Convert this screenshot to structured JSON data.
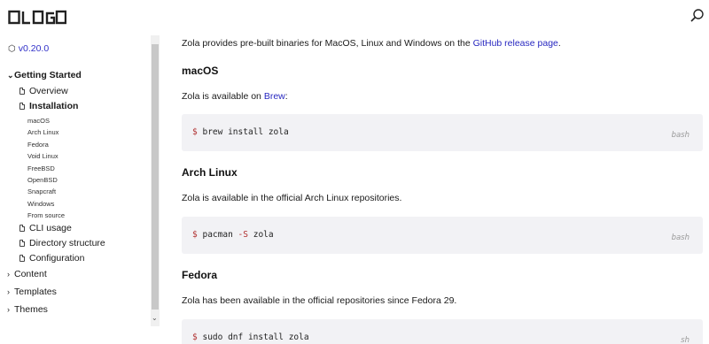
{
  "header": {
    "logo_text": "LOGO",
    "search_icon": "search-icon"
  },
  "sidebar": {
    "version": "v0.20.0",
    "sections": [
      {
        "label": "Getting Started",
        "expanded": true
      },
      {
        "label": "Content",
        "expanded": false
      },
      {
        "label": "Templates",
        "expanded": false
      },
      {
        "label": "Themes",
        "expanded": false
      }
    ],
    "getting_started_items": [
      {
        "label": "Overview"
      },
      {
        "label": "Installation",
        "active": true
      },
      {
        "label": "CLI usage"
      },
      {
        "label": "Directory structure"
      },
      {
        "label": "Configuration"
      }
    ],
    "installation_subitems": [
      "macOS",
      "Arch Linux",
      "Fedora",
      "Void Linux",
      "FreeBSD",
      "OpenBSD",
      "Snapcraft",
      "Windows",
      "From source"
    ]
  },
  "main": {
    "intro_prefix": "Zola provides pre-built binaries for MacOS, Linux and Windows on the ",
    "intro_link": "GitHub release page",
    "intro_suffix": ".",
    "macos": {
      "heading": "macOS",
      "text_prefix": "Zola is available on ",
      "text_link": "Brew",
      "text_suffix": ":",
      "code": {
        "prompt": "$",
        "command": "brew install zola",
        "lang": "bash"
      }
    },
    "arch": {
      "heading": "Arch Linux",
      "text": "Zola is available in the official Arch Linux repositories.",
      "code": {
        "prompt": "$",
        "cmd_a": "pacman",
        "flag": "-S",
        "cmd_b": "zola",
        "lang": "bash"
      }
    },
    "fedora": {
      "heading": "Fedora",
      "text": "Zola has been available in the official repositories since Fedora 29.",
      "code": {
        "prompt": "$",
        "command": "sudo dnf install zola",
        "lang": "sh"
      }
    }
  }
}
